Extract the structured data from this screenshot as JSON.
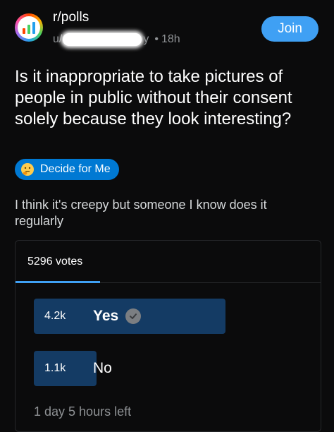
{
  "post": {
    "subreddit": "r/polls",
    "user_prefix": "u/",
    "user_suffix": "y",
    "time_ago": "18h",
    "join_label": "Join",
    "title": "Is it inappropriate to take pictures of people in public without their consent solely because they look interesting?",
    "flair_label": "Decide for Me",
    "body": "I think it's creepy but someone I know does it regularly"
  },
  "poll": {
    "votes_label": "5296 votes",
    "options": [
      {
        "count": "4.2k",
        "label": "Yes",
        "fraction": 0.8,
        "selected": true
      },
      {
        "count": "1.1k",
        "label": "No",
        "fraction": 0.21,
        "selected": false
      }
    ],
    "time_left": "1 day 5 hours left"
  },
  "colors": {
    "background": "#0b0b0c",
    "accent_blue": "#3fa0f4",
    "flair_blue": "#0079d3",
    "poll_bar": "#143b64"
  },
  "icons": {
    "avatar": "poll-chart-icon",
    "flair": "thinking-face-icon",
    "selected_option": "check-circle-icon"
  }
}
